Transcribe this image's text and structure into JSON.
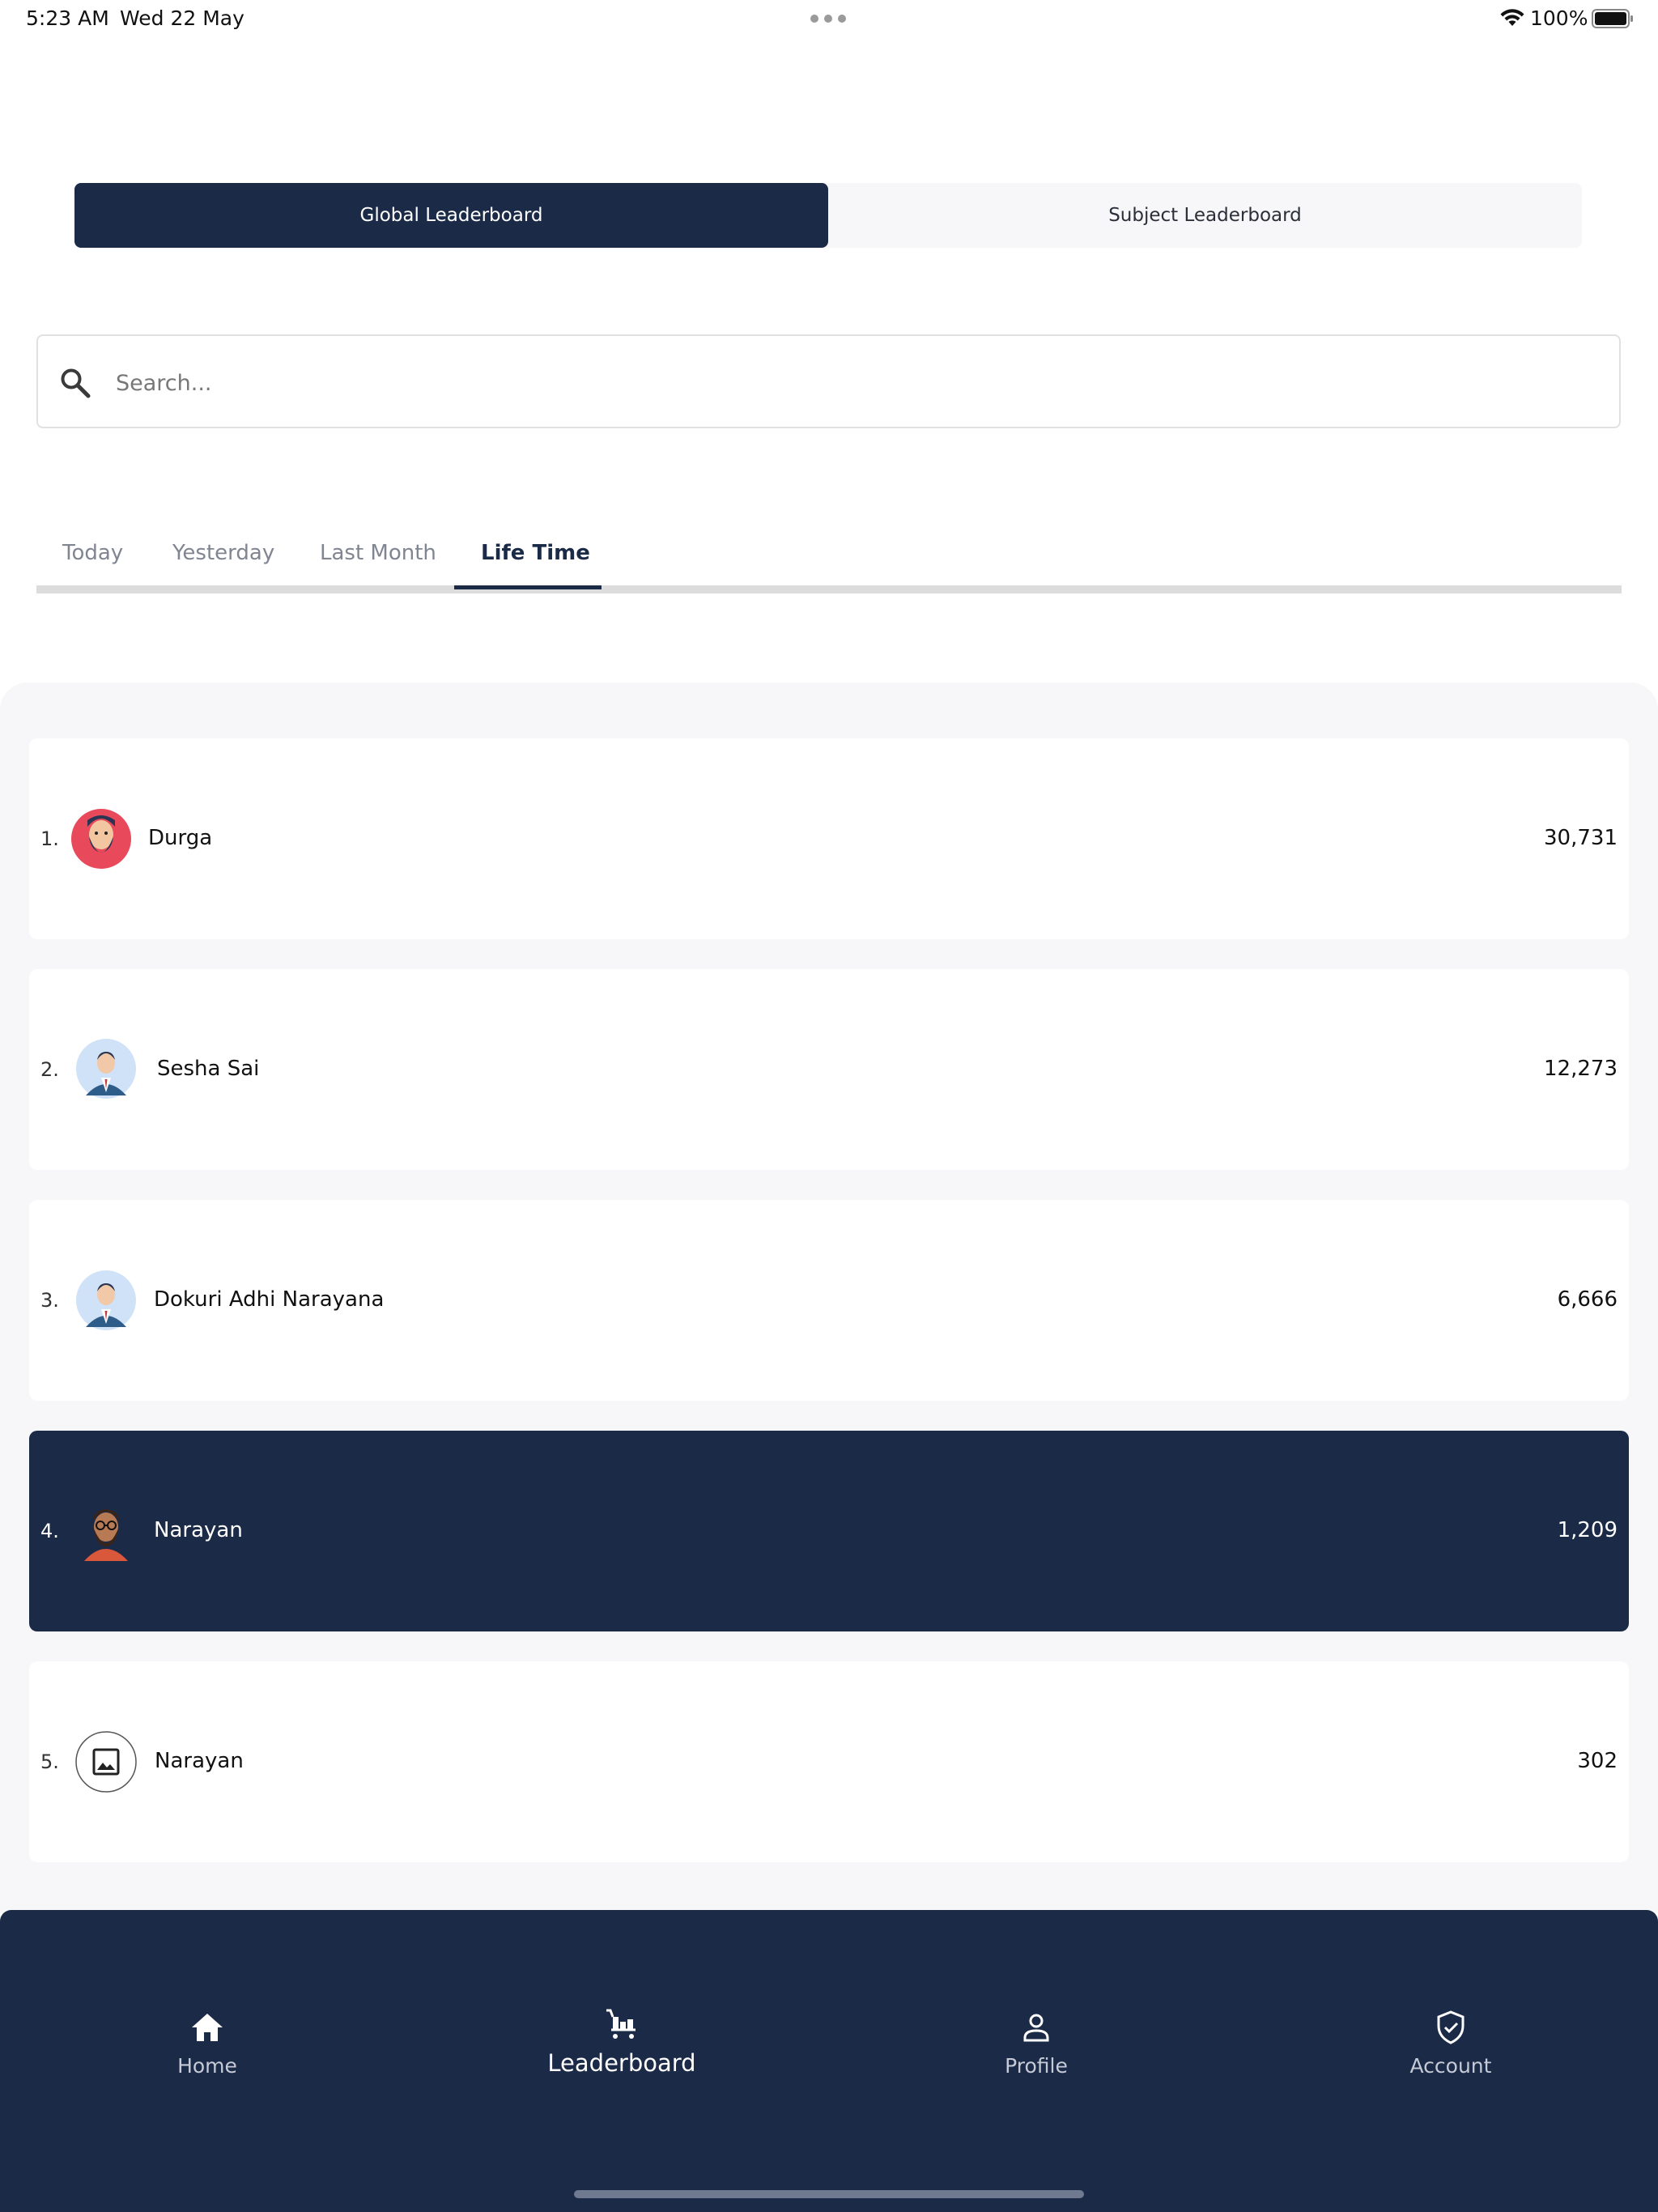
{
  "status_bar": {
    "time": "5:23 AM",
    "date": "Wed 22 May",
    "battery": "100%"
  },
  "segments": [
    {
      "label": "Global Leaderboard",
      "active": true
    },
    {
      "label": "Subject Leaderboard",
      "active": false
    }
  ],
  "search": {
    "placeholder": "Search...",
    "value": ""
  },
  "tabs": [
    {
      "label": "Today"
    },
    {
      "label": "Yesterday"
    },
    {
      "label": "Last Month"
    },
    {
      "label": "Life Time",
      "active": true
    }
  ],
  "leaderboard": [
    {
      "rank": "1.",
      "name": "Durga",
      "score": "30,731",
      "avatar": "avatar-bearded-man-red-icon"
    },
    {
      "rank": "2.",
      "name": "Sesha Sai",
      "score": "12,273",
      "avatar": "avatar-man-suit-icon"
    },
    {
      "rank": "3.",
      "name": "Dokuri Adhi Narayana",
      "score": "6,666",
      "avatar": "avatar-man-suit-icon"
    },
    {
      "rank": "4.",
      "name": "Narayan",
      "score": "1,209",
      "avatar": "avatar-bearded-man-glasses-icon",
      "highlighted": true
    },
    {
      "rank": "5.",
      "name": "Narayan",
      "score": "302",
      "avatar": "image-placeholder-icon"
    }
  ],
  "nav": [
    {
      "label": "Home",
      "icon": "home-icon"
    },
    {
      "label": "Leaderboard",
      "icon": "leaderboard-icon",
      "active": true
    },
    {
      "label": "Profile",
      "icon": "profile-icon"
    },
    {
      "label": "Account",
      "icon": "shield-check-icon"
    }
  ],
  "colors": {
    "primary": "#1b2a47",
    "panel_bg": "#f7f6f8",
    "tab_inactive": "#808592"
  }
}
